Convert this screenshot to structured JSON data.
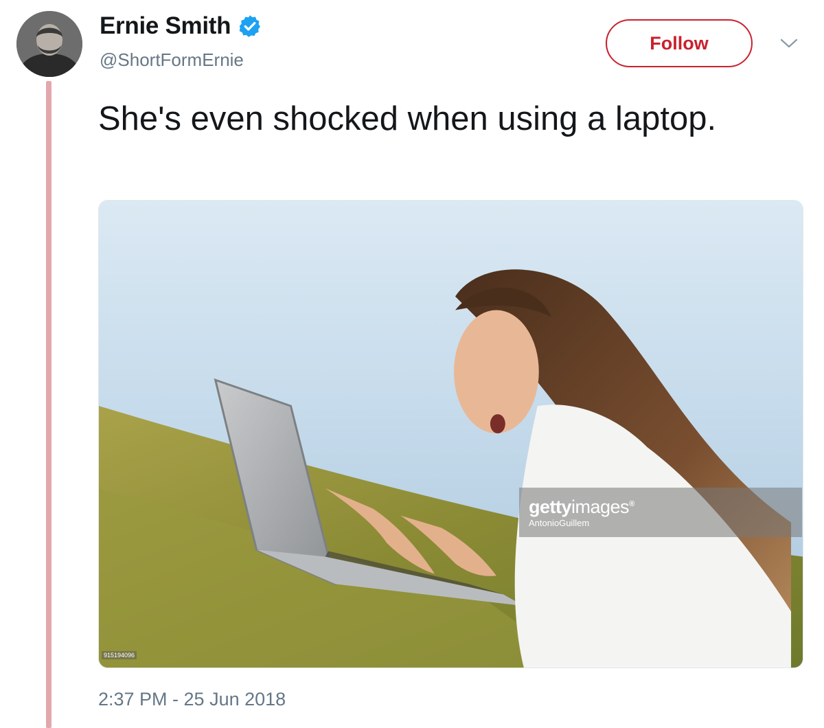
{
  "tweet": {
    "author": {
      "display_name": "Ernie Smith",
      "handle": "@ShortFormErnie",
      "verified": true,
      "avatar_icon": "user-avatar"
    },
    "follow_label": "Follow",
    "menu_icon": "chevron-down-icon",
    "text": "She's even shocked when using a laptop.",
    "timestamp": "2:37 PM - 25 Jun 2018",
    "media": {
      "description_icon": "photo",
      "watermark": {
        "brand_bold": "getty",
        "brand_light": "images",
        "registered_mark": "®",
        "credit": "AntonioGuillem"
      },
      "image_id": "915194096"
    }
  },
  "colors": {
    "follow_accent": "#c8212e",
    "thread_line": "#e3a8ac",
    "secondary_text": "#657786",
    "verified_blue": "#1da1f2"
  }
}
